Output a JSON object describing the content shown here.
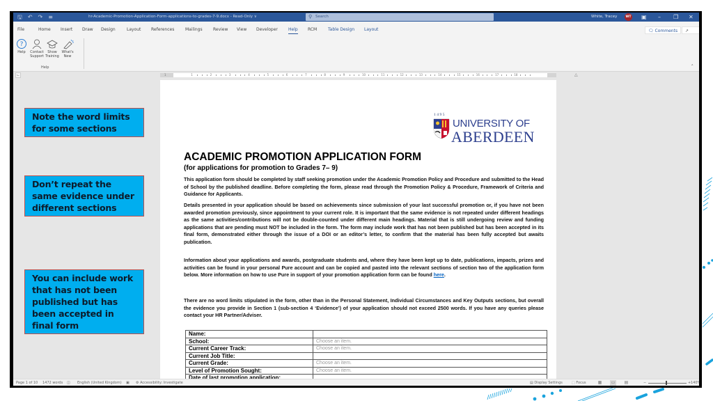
{
  "titlebar": {
    "quick_access": [
      "save-icon",
      "undo-icon",
      "redo-icon",
      "customize-icon"
    ],
    "document_title": "hr-Academic-Promotion-Application-Form-applications-to-grades-7-9.docx  -  Read-Only  ∨",
    "search_placeholder": "Search",
    "user_name": "White, Tracey",
    "user_initials": "WT",
    "controls": [
      "ribbon-display-icon",
      "minimize-icon",
      "restore-icon",
      "close-icon"
    ]
  },
  "menu": {
    "tabs": [
      {
        "label": "File"
      },
      {
        "label": "Home"
      },
      {
        "label": "Insert"
      },
      {
        "label": "Draw"
      },
      {
        "label": "Design"
      },
      {
        "label": "Layout"
      },
      {
        "label": "References"
      },
      {
        "label": "Mailings"
      },
      {
        "label": "Review"
      },
      {
        "label": "View"
      },
      {
        "label": "Developer"
      },
      {
        "label": "Help"
      },
      {
        "label": "RCM"
      },
      {
        "label": "Table Design"
      },
      {
        "label": "Layout"
      }
    ],
    "active_tab": "Help",
    "comments_label": "Comments",
    "share_label": "Share"
  },
  "ribbon": {
    "group_label": "Help",
    "buttons": [
      {
        "label": "Help",
        "icon": "help-icon"
      },
      {
        "label": "Contact Support",
        "icon": "contact-support-icon"
      },
      {
        "label": "Show Training",
        "icon": "training-icon"
      },
      {
        "label": "What's New",
        "icon": "whats-new-icon"
      }
    ]
  },
  "ruler": {
    "numbers": [
      "1",
      "1",
      "2",
      "3",
      "4",
      "5",
      "6",
      "7",
      "8",
      "9",
      "10",
      "11",
      "12",
      "13",
      "14",
      "15",
      "16",
      "17",
      "18"
    ]
  },
  "callouts": [
    {
      "text": "Note the word limits for some sections",
      "color": "#00aeef"
    },
    {
      "text": "Don’t repeat the same evidence under different sections",
      "color": "#00aeef"
    },
    {
      "text": "You can include work that has not been published but has been accepted in final form",
      "color": "#00aeef"
    }
  ],
  "document": {
    "logo": {
      "year": "1495",
      "line1": "UNIVERSITY OF",
      "line2": "ABERDEEN"
    },
    "title": "ACADEMIC PROMOTION APPLICATION FORM",
    "subtitle": "(for applications for promotion to Grades 7– 9)",
    "paragraphs": [
      "This application form should be completed by staff seeking promotion under the Academic Promotion Policy and Procedure and submitted to the Head of School by the published deadline. Before completing the form, please read through the Promotion Policy & Procedure, Framework of Criteria and Guidance for Applicants.",
      "Details presented in your application should be based on achievements since submission of your last successful promotion or, if you have not been awarded promotion previously, since appointment to your current role. It is important that the same evidence is not repeated under different headings as the same activities/contributions will not be double-counted under different main headings. Material that is still undergoing review and funding applications that are pending must NOT be included in the form. The form may include work that has not been published but has been accepted in its final form, demonstrated either through the issue of a DOI or an editor’s letter, to confirm that the material has been fully accepted but awaits publication.",
      "Information about your applications and awards, postgraduate students and, where they have been kept up to date, publications, impacts, prizes and activities can be found in your personal Pure account and can be copied and pasted into the relevant sections of section two of the application form below.  More information on how to use Pure in support of your promotion application form can be found",
      "There are no word limits stipulated in the form, other than in the Personal Statement, Individual Circumstances and Key Outputs sections, but overall the evidence you provide in Section 1 (sub-section 4 ‘Evidence’) of your application should not exceed 2500 words. If you have any queries please contact your HR Partner/Adviser."
    ],
    "link_text": "here",
    "link_suffix": ".",
    "form_rows": [
      {
        "label": "Name:",
        "value": ""
      },
      {
        "label": "School:",
        "value": "Choose an item."
      },
      {
        "label": "Current Career Track:",
        "value": "Choose an item."
      },
      {
        "label": "Current Job Title:",
        "value": ""
      },
      {
        "label": "Current Grade:",
        "value": "Choose an item."
      },
      {
        "label": "Level of Promotion Sought:",
        "value": "Choose an item."
      },
      {
        "label": "Date of last promotion application:",
        "value": ""
      }
    ]
  },
  "statusbar": {
    "page": "Page 1 of 10",
    "words": "1472 words",
    "language": "English (United Kingdom)",
    "accessibility": "Accessibility: Investigate",
    "display_settings": "Display Settings",
    "focus": "Focus",
    "zoom_minus": "−",
    "zoom_plus": "+",
    "zoom_level": "140%"
  },
  "colors": {
    "titlebar": "#2b579a",
    "callout_fill": "#00aeef",
    "callout_border": "#c0504d",
    "logo_blue": "#2d3f8e",
    "deco_cyan": "#1aa3dd"
  }
}
